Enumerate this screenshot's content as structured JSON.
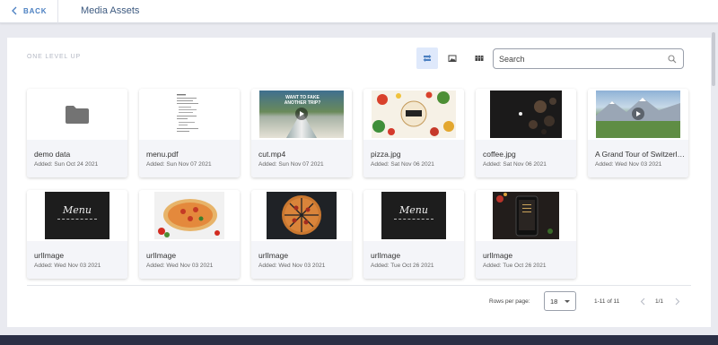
{
  "header": {
    "back_label": "BACK",
    "title": "Media Assets"
  },
  "toolbar": {
    "level_up": "ONE LEVEL UP",
    "search_placeholder": "Search"
  },
  "assets": [
    {
      "name": "demo data",
      "added": "Added: Sun Oct 24 2021",
      "thumb": "folder"
    },
    {
      "name": "menu.pdf",
      "added": "Added: Sun Nov 07 2021",
      "thumb": "document"
    },
    {
      "name": "cut.mp4",
      "added": "Added: Sun Nov 07 2021",
      "thumb": "video-road",
      "overlay": "WANT TO FAKE ANOTHER TRIP?"
    },
    {
      "name": "pizza.jpg",
      "added": "Added: Sat Nov 06 2021",
      "thumb": "pizza-poster"
    },
    {
      "name": "coffee.jpg",
      "added": "Added: Sat Nov 06 2021",
      "thumb": "coffee"
    },
    {
      "name": "A Grand Tour of Switzerland",
      "added": "Added: Wed Nov 03 2021",
      "thumb": "video-mountains"
    },
    {
      "name": "urlImage",
      "added": "Added: Wed Nov 03 2021",
      "thumb": "chalkboard",
      "overlay": "Menu"
    },
    {
      "name": "urlImage",
      "added": "Added: Wed Nov 03 2021",
      "thumb": "pizza-plate"
    },
    {
      "name": "urlImage",
      "added": "Added: Wed Nov 03 2021",
      "thumb": "pizza-dark"
    },
    {
      "name": "urlImage",
      "added": "Added: Tue Oct 26 2021",
      "thumb": "chalkboard",
      "overlay": "Menu"
    },
    {
      "name": "urlImage",
      "added": "Added: Tue Oct 26 2021",
      "thumb": "phone"
    }
  ],
  "pagination": {
    "rows_label": "Rows per page:",
    "rows_value": "18",
    "range": "1-11 of 11",
    "page": "1/1"
  },
  "colors": {
    "accent": "#4a7fc1",
    "active_view_bg": "#dfe9fb",
    "bottom_bar": "#2b2f45"
  }
}
